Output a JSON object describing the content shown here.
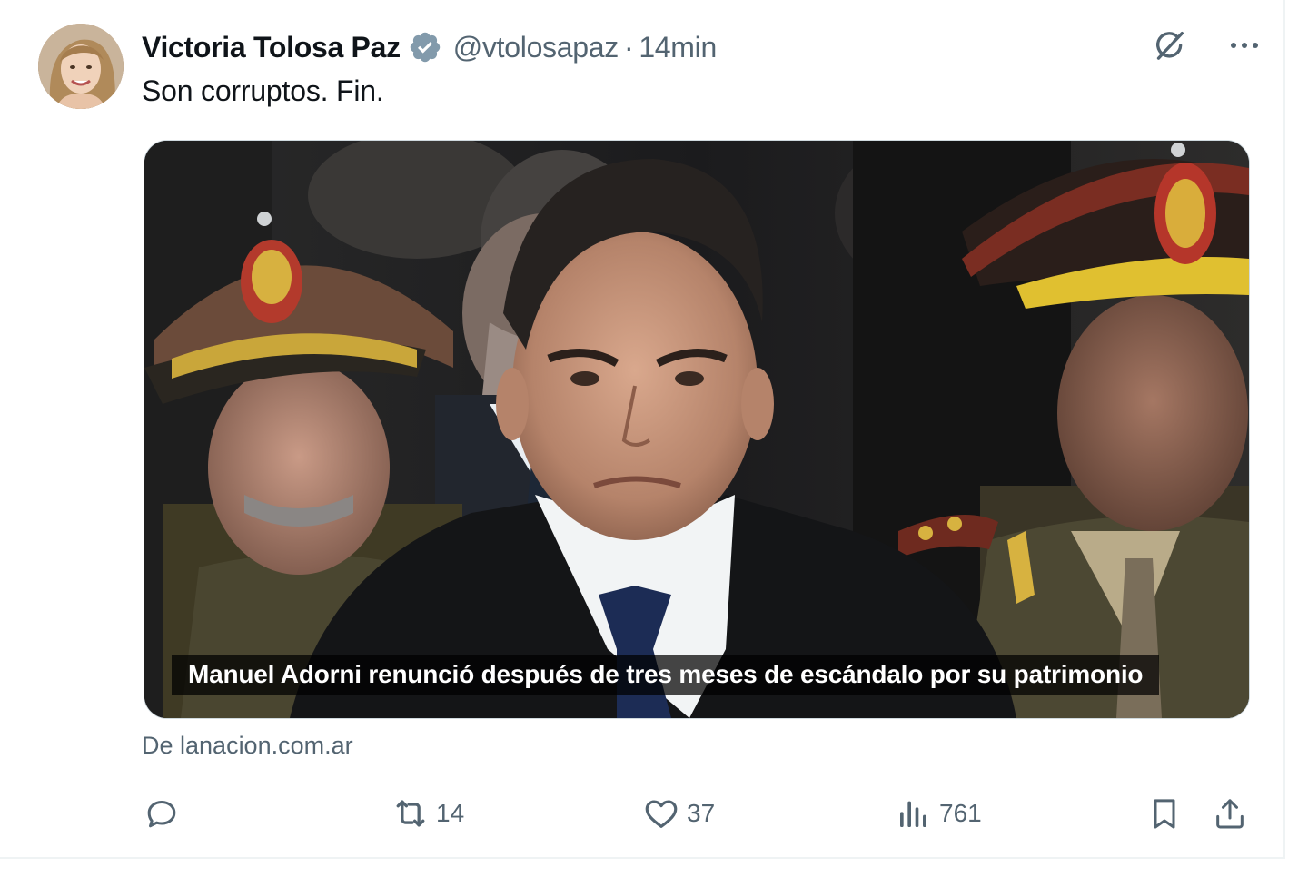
{
  "tweet": {
    "author": {
      "display_name": "Victoria Tolosa Paz",
      "handle": "@vtolosapaz",
      "verified": true,
      "avatar_icon": "avatar-photo"
    },
    "separator": "·",
    "time": "14min",
    "text": "Son corruptos. Fin.",
    "media": {
      "caption": "Manuel Adorni renunció después de tres meses de escándalo por su patrimonio"
    },
    "source": "De lanacion.com.ar",
    "metrics": {
      "replies": "",
      "retweets": "14",
      "likes": "37",
      "views": "761"
    }
  },
  "icons": {
    "verified": "verified-badge-icon",
    "grok": "grok-icon",
    "more": "more-icon",
    "reply": "reply-icon",
    "retweet": "retweet-icon",
    "like": "heart-icon",
    "views": "views-icon",
    "bookmark": "bookmark-icon",
    "share": "share-icon"
  },
  "colors": {
    "text_primary": "#0f1419",
    "text_secondary": "#536471",
    "verified_badge": "#829aab",
    "border": "#eff3f4"
  }
}
